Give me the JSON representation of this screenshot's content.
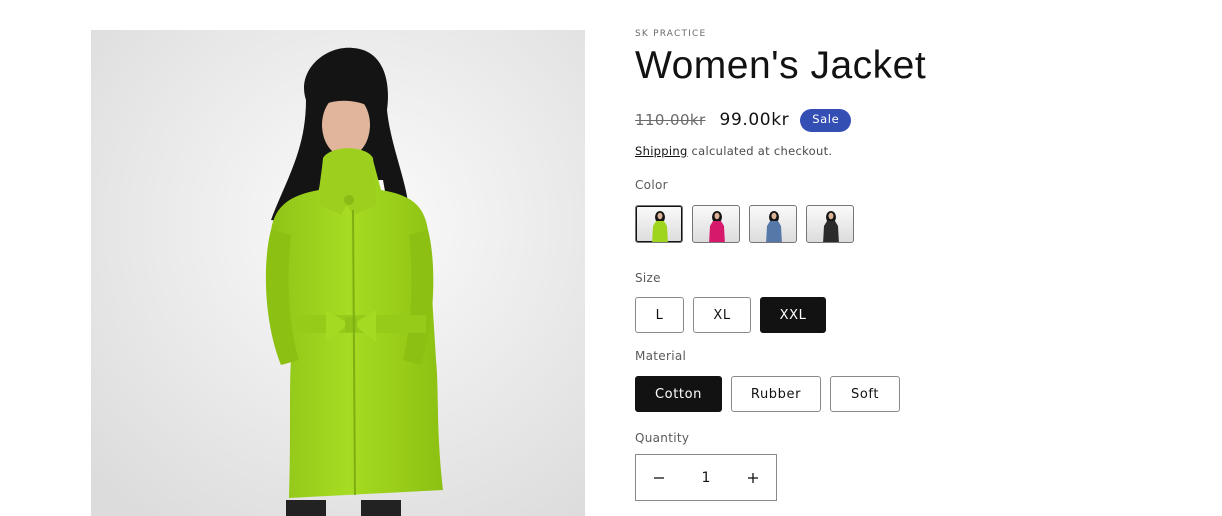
{
  "product": {
    "vendor": "SK PRACTICE",
    "title": "Women's Jacket",
    "image_icon": "product-photo",
    "price_compare": "110.00kr",
    "price_sale": "99.00kr",
    "sale_badge": "Sale",
    "shipping_link": "Shipping",
    "shipping_text": " calculated at checkout."
  },
  "options": {
    "color": {
      "label": "Color",
      "swatches": [
        {
          "name": "lime",
          "color": "#9fd61d",
          "selected": true
        },
        {
          "name": "pink",
          "color": "#d6196a",
          "selected": false
        },
        {
          "name": "blue",
          "color": "#5578a8",
          "selected": false
        },
        {
          "name": "black",
          "color": "#2b2b2b",
          "selected": false
        }
      ]
    },
    "size": {
      "label": "Size",
      "values": [
        "L",
        "XL",
        "XXL"
      ],
      "selected": "XXL"
    },
    "material": {
      "label": "Material",
      "values": [
        "Cotton",
        "Rubber",
        "Soft"
      ],
      "selected": "Cotton"
    }
  },
  "quantity": {
    "label": "Quantity",
    "value": "1",
    "minus_icon": "minus-icon",
    "plus_icon": "plus-icon"
  },
  "colors": {
    "accent_sale": "#334fb4",
    "text": "#121212",
    "jacket": "#9fd61d"
  }
}
